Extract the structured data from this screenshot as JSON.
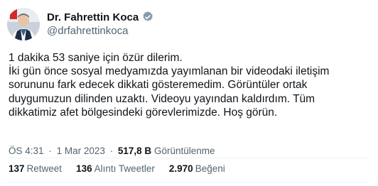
{
  "author": {
    "display_name": "Dr. Fahrettin Koca",
    "handle": "@drfahrettinkoca",
    "verified_icon": "verified-badge-icon",
    "verified_color": "#829aab"
  },
  "tweet": {
    "lines": [
      "1 dakika 53 saniye için özür dilerim.",
      "İki gün önce sosyal medyamızda yayımlanan bir videodaki iletişim",
      "sorununu fark edecek dikkati gösteremedim. Görüntüler ortak",
      "duygumuzun dilinden uzaktı. Videoyu yayından kaldırdım. Tüm",
      "dikkatimiz afet bölgesindeki görevlerimizde. Hoş görün."
    ]
  },
  "meta": {
    "time": "ÖS 4:31",
    "separator": "·",
    "date": "1 Mar 2023",
    "views_count": "517,8 B",
    "views_label": "Görüntülenme"
  },
  "stats": [
    {
      "count": "137",
      "label": "Retweet"
    },
    {
      "count": "136",
      "label": "Alıntı Tweetler"
    },
    {
      "count": "2.970",
      "label": "Beğeni"
    }
  ],
  "colors": {
    "text": "#0f1419",
    "secondary": "#536471",
    "divider": "#eff3f4"
  }
}
